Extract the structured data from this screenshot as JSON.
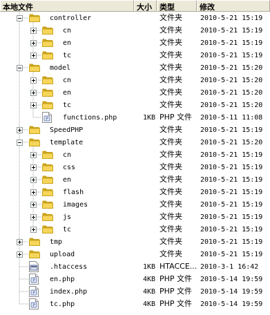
{
  "columns": {
    "name": "本地文件",
    "size": "大小",
    "type": "类型",
    "modified": "修改"
  },
  "colors": {
    "folder": "#f5d65b",
    "folder_dark": "#c9a21a",
    "header_bg": "#ece9d8"
  },
  "rows": [
    {
      "name": "controller",
      "size": "",
      "type": "文件夹",
      "modified": "2010-5-21 15:19",
      "kind": "folder",
      "depth": 1,
      "toggle": "minus"
    },
    {
      "name": "cn",
      "size": "",
      "type": "文件夹",
      "modified": "2010-5-21 15:19",
      "kind": "folder",
      "depth": 2,
      "toggle": "plus"
    },
    {
      "name": "en",
      "size": "",
      "type": "文件夹",
      "modified": "2010-5-21 15:19",
      "kind": "folder",
      "depth": 2,
      "toggle": "plus"
    },
    {
      "name": "tc",
      "size": "",
      "type": "文件夹",
      "modified": "2010-5-21 15:19",
      "kind": "folder",
      "depth": 2,
      "toggle": "plus"
    },
    {
      "name": "model",
      "size": "",
      "type": "文件夹",
      "modified": "2010-5-21 15:20",
      "kind": "folder",
      "depth": 1,
      "toggle": "minus"
    },
    {
      "name": "cn",
      "size": "",
      "type": "文件夹",
      "modified": "2010-5-21 15:20",
      "kind": "folder",
      "depth": 2,
      "toggle": "plus"
    },
    {
      "name": "en",
      "size": "",
      "type": "文件夹",
      "modified": "2010-5-21 15:20",
      "kind": "folder",
      "depth": 2,
      "toggle": "plus"
    },
    {
      "name": "tc",
      "size": "",
      "type": "文件夹",
      "modified": "2010-5-21 15:20",
      "kind": "folder",
      "depth": 2,
      "toggle": "plus"
    },
    {
      "name": "functions.php",
      "size": "1KB",
      "type": "PHP 文件",
      "modified": "2010-5-11 11:08",
      "kind": "php",
      "depth": 2,
      "toggle": "none"
    },
    {
      "name": "SpeedPHP",
      "size": "",
      "type": "文件夹",
      "modified": "2010-5-21 15:19",
      "kind": "folder",
      "depth": 1,
      "toggle": "plus"
    },
    {
      "name": "template",
      "size": "",
      "type": "文件夹",
      "modified": "2010-5-21 15:20",
      "kind": "folder",
      "depth": 1,
      "toggle": "minus"
    },
    {
      "name": "cn",
      "size": "",
      "type": "文件夹",
      "modified": "2010-5-21 15:19",
      "kind": "folder",
      "depth": 2,
      "toggle": "plus"
    },
    {
      "name": "css",
      "size": "",
      "type": "文件夹",
      "modified": "2010-5-21 15:19",
      "kind": "folder",
      "depth": 2,
      "toggle": "plus"
    },
    {
      "name": "en",
      "size": "",
      "type": "文件夹",
      "modified": "2010-5-21 15:19",
      "kind": "folder",
      "depth": 2,
      "toggle": "plus"
    },
    {
      "name": "flash",
      "size": "",
      "type": "文件夹",
      "modified": "2010-5-21 15:19",
      "kind": "folder",
      "depth": 2,
      "toggle": "plus"
    },
    {
      "name": "images",
      "size": "",
      "type": "文件夹",
      "modified": "2010-5-21 15:19",
      "kind": "folder",
      "depth": 2,
      "toggle": "plus"
    },
    {
      "name": "js",
      "size": "",
      "type": "文件夹",
      "modified": "2010-5-21 15:19",
      "kind": "folder",
      "depth": 2,
      "toggle": "plus"
    },
    {
      "name": "tc",
      "size": "",
      "type": "文件夹",
      "modified": "2010-5-21 15:19",
      "kind": "folder",
      "depth": 2,
      "toggle": "plus"
    },
    {
      "name": "tmp",
      "size": "",
      "type": "文件夹",
      "modified": "2010-5-21 15:19",
      "kind": "folder",
      "depth": 1,
      "toggle": "plus"
    },
    {
      "name": "upload",
      "size": "",
      "type": "文件夹",
      "modified": "2010-5-21 15:19",
      "kind": "folder",
      "depth": 1,
      "toggle": "plus"
    },
    {
      "name": ".htaccess",
      "size": "1KB",
      "type": "HTACCE...",
      "modified": "2010-3-1 16:42",
      "kind": "generic",
      "depth": 1,
      "toggle": "none"
    },
    {
      "name": "en.php",
      "size": "4KB",
      "type": "PHP 文件",
      "modified": "2010-5-14 19:59",
      "kind": "php",
      "depth": 1,
      "toggle": "none"
    },
    {
      "name": "index.php",
      "size": "4KB",
      "type": "PHP 文件",
      "modified": "2010-5-14 19:59",
      "kind": "php",
      "depth": 1,
      "toggle": "none"
    },
    {
      "name": "tc.php",
      "size": "4KB",
      "type": "PHP 文件",
      "modified": "2010-5-14 19:59",
      "kind": "php",
      "depth": 1,
      "toggle": "none"
    }
  ]
}
